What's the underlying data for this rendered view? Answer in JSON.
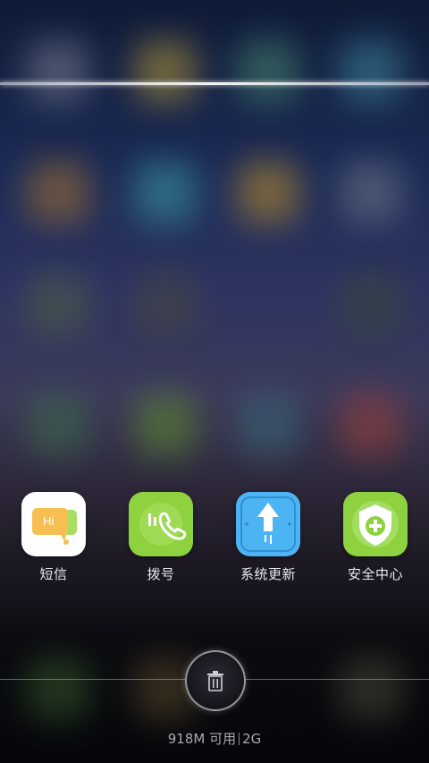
{
  "apps": [
    {
      "label": "短信",
      "icon": "messages-icon",
      "bubble_text": "Hi"
    },
    {
      "label": "拨号",
      "icon": "phone-dialer-icon"
    },
    {
      "label": "系统更新",
      "icon": "system-update-icon"
    },
    {
      "label": "安全中心",
      "icon": "security-shield-icon"
    }
  ],
  "memory": {
    "available": "918M 可用",
    "total": "2G"
  },
  "colors": {
    "messages_tile": "#ffffff",
    "messages_bubble_front": "#f7bf52",
    "messages_bubble_back": "#a6df5f",
    "dialer_tile": "#8fd23f",
    "update_tile": "#4db4f4",
    "security_tile": "#8fd23f"
  }
}
